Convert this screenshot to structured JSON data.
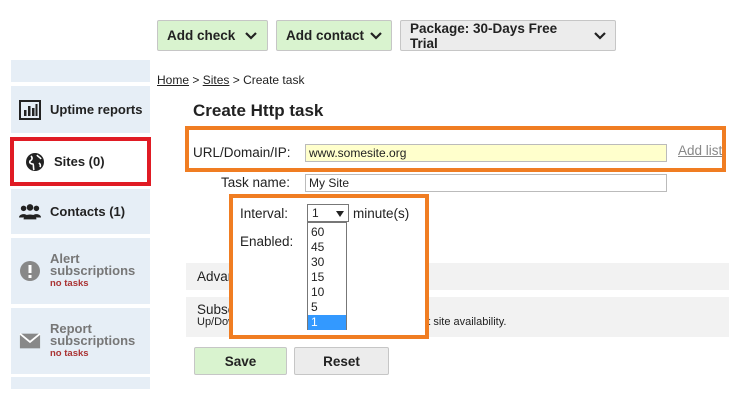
{
  "toolbar": {
    "add_check": "Add check",
    "add_contact": "Add contact",
    "package": "Package: 30-Days Free Trial"
  },
  "sidebar": {
    "items": [
      {
        "label": "Uptime reports",
        "icon": "bar-chart-icon"
      },
      {
        "label": "Sites (0)",
        "icon": "globe-icon"
      },
      {
        "label": "Contacts (1)",
        "icon": "contacts-icon"
      },
      {
        "label": "Alert subscriptions",
        "sub": "no tasks",
        "icon": "alert-icon"
      },
      {
        "label": "Report subscriptions",
        "sub": "no tasks",
        "icon": "mail-icon"
      }
    ]
  },
  "breadcrumb": {
    "home": "Home",
    "sep1": " > ",
    "sites": "Sites",
    "sep2": " > ",
    "current": "Create task"
  },
  "page_title": "Create Http task",
  "form": {
    "url_label": "URL/Domain/IP:",
    "url_value": "www.somesite.org",
    "add_list": "Add list",
    "task_name_label": "Task name:",
    "task_name_value": "My Site",
    "interval_label": "Interval:",
    "interval_value": "1",
    "interval_unit": "minute(s)",
    "interval_options": [
      "60",
      "45",
      "30",
      "15",
      "10",
      "5",
      "1"
    ],
    "enabled_label": "Enabled:",
    "advanced_options": "Advanced options",
    "subscriptions": "Subscriptions",
    "subscriptions_desc_a": "Up/Down alerts and",
    "subscriptions_desc_b": "tatistics about site availability."
  },
  "buttons": {
    "save": "Save",
    "reset": "Reset"
  },
  "colors": {
    "accent_green": "#d9f3cf",
    "highlight_red": "#e01b24",
    "highlight_orange": "#f07d22",
    "url_field_bg": "#ffffcc",
    "sidebar_bg": "#e6eef6",
    "selected_option": "#3399ff"
  }
}
